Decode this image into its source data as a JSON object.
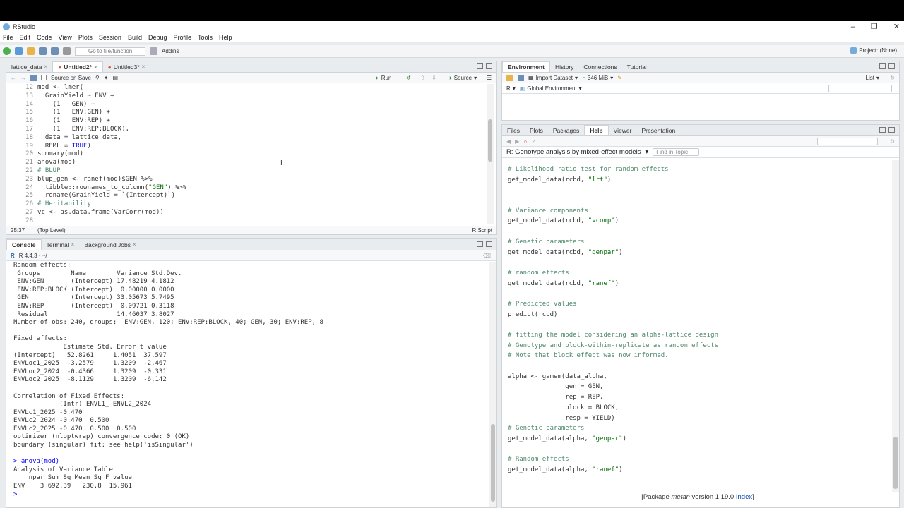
{
  "app": {
    "title": "RStudio"
  },
  "menu": [
    "File",
    "Edit",
    "Code",
    "View",
    "Plots",
    "Session",
    "Build",
    "Debug",
    "Profile",
    "Tools",
    "Help"
  ],
  "toolbar": {
    "goto_placeholder": "Go to file/function",
    "addins": "Addins",
    "project": "Project: (None)"
  },
  "editor": {
    "tabs": [
      {
        "label": "lattice_data",
        "active": false
      },
      {
        "label": "Untitled2*",
        "active": true
      },
      {
        "label": "Untitled3*",
        "active": false
      }
    ],
    "source_on_save": "Source on Save",
    "run": "Run",
    "source": "Source",
    "line_numbers": [
      "12",
      "13",
      "14",
      "15",
      "16",
      "17",
      "18",
      "19",
      "20",
      "21",
      "22",
      "23",
      "24",
      "25",
      "26",
      "27",
      "28"
    ],
    "lines": [
      "mod <- lmer(",
      "  GrainYield ~ ENV +",
      "    (1 | GEN) +",
      "    (1 | ENV:GEN) +",
      "    (1 | ENV:REP) +",
      "    (1 | ENV:REP:BLOCK),",
      "  data = lattice_data,",
      "  REML = TRUE)",
      "summary(mod)",
      "anova(mod)",
      "# BLUP",
      "blup_gen <- ranef(mod)$GEN %>%",
      "  tibble::rownames_to_column(\"GEN\") %>%",
      "  rename(GrainYield = `(Intercept)`)",
      "# Heritability",
      "vc <- as.data.frame(VarCorr(mod))",
      ""
    ],
    "cursor": "25:37",
    "scope": "(Top Level)",
    "filetype": "R Script"
  },
  "console": {
    "tabs": [
      "Console",
      "Terminal",
      "Background Jobs"
    ],
    "r_version": "R 4.4.3 · ~/",
    "lines": [
      "Random effects:",
      " Groups        Name        Variance Std.Dev.",
      " ENV:GEN       (Intercept) 17.48219 4.1812  ",
      " ENV:REP:BLOCK (Intercept)  0.00000 0.0000  ",
      " GEN           (Intercept) 33.05673 5.7495  ",
      " ENV:REP       (Intercept)  0.09721 0.3118  ",
      " Residual                  14.46037 3.8027  ",
      "Number of obs: 240, groups:  ENV:GEN, 120; ENV:REP:BLOCK, 40; GEN, 30; ENV:REP, 8",
      "",
      "Fixed effects:",
      "             Estimate Std. Error t value",
      "(Intercept)   52.8261     1.4051  37.597",
      "ENVLoc1_2025  -3.2579     1.3209  -2.467",
      "ENVLoc2_2024  -0.4366     1.3209  -0.331",
      "ENVLoc2_2025  -8.1129     1.3209  -6.142",
      "",
      "Correlation of Fixed Effects:",
      "            (Intr) ENVL1_ ENVL2_2024",
      "ENVLc1_2025 -0.470                  ",
      "ENVLc2_2024 -0.470  0.500           ",
      "ENVLc2_2025 -0.470  0.500  0.500    ",
      "optimizer (nloptwrap) convergence code: 0 (OK)",
      "boundary (singular) fit: see help('isSingular')",
      ""
    ],
    "cmd_prompt": "> ",
    "cmd": "anova(mod)",
    "after_lines": [
      "Analysis of Variance Table",
      "    npar Sum Sq Mean Sq F value",
      "ENV    3 692.39   230.8  15.961"
    ],
    "final_prompt": "> "
  },
  "env": {
    "tabs": [
      "Environment",
      "History",
      "Connections",
      "Tutorial"
    ],
    "import_dataset": "Import Dataset",
    "memory": "346 MiB",
    "view_mode": "List",
    "lang": "R",
    "scope": "Global Environment"
  },
  "help": {
    "tabs": [
      "Files",
      "Plots",
      "Packages",
      "Help",
      "Viewer",
      "Presentation"
    ],
    "topic": "R: Genotype analysis by mixed-effect models",
    "find_placeholder": "Find in Topic",
    "lines": [
      "# Likelihood ratio test for random effects",
      "get_model_data(rcbd, \"lrt\")",
      "",
      "",
      "# Variance components",
      "get_model_data(rcbd, \"vcomp\")",
      "",
      "# Genetic parameters",
      "get_model_data(rcbd, \"genpar\")",
      "",
      "# random effects",
      "get_model_data(rcbd, \"ranef\")",
      "",
      "# Predicted values",
      "predict(rcbd)",
      "",
      "# fitting the model considering an alpha-lattice design",
      "# Genotype and block-within-replicate as random effects",
      "# Note that block effect was now informed.",
      "",
      "alpha <- gamem(data_alpha,",
      "               gen = GEN,",
      "               rep = REP,",
      "               block = BLOCK,",
      "               resp = YIELD)",
      "# Genetic parameters",
      "get_model_data(alpha, \"genpar\")",
      "",
      "# Random effects",
      "get_model_data(alpha, \"ranef\")"
    ],
    "footer_prefix": "[Package ",
    "footer_pkg": "metan",
    "footer_version": " version 1.19.0 ",
    "footer_link": "Index",
    "footer_suffix": "]"
  },
  "colors": {
    "accent": "#75aadb",
    "keyword": "#0000ff",
    "string": "#036a07",
    "comment": "#4c886b"
  }
}
